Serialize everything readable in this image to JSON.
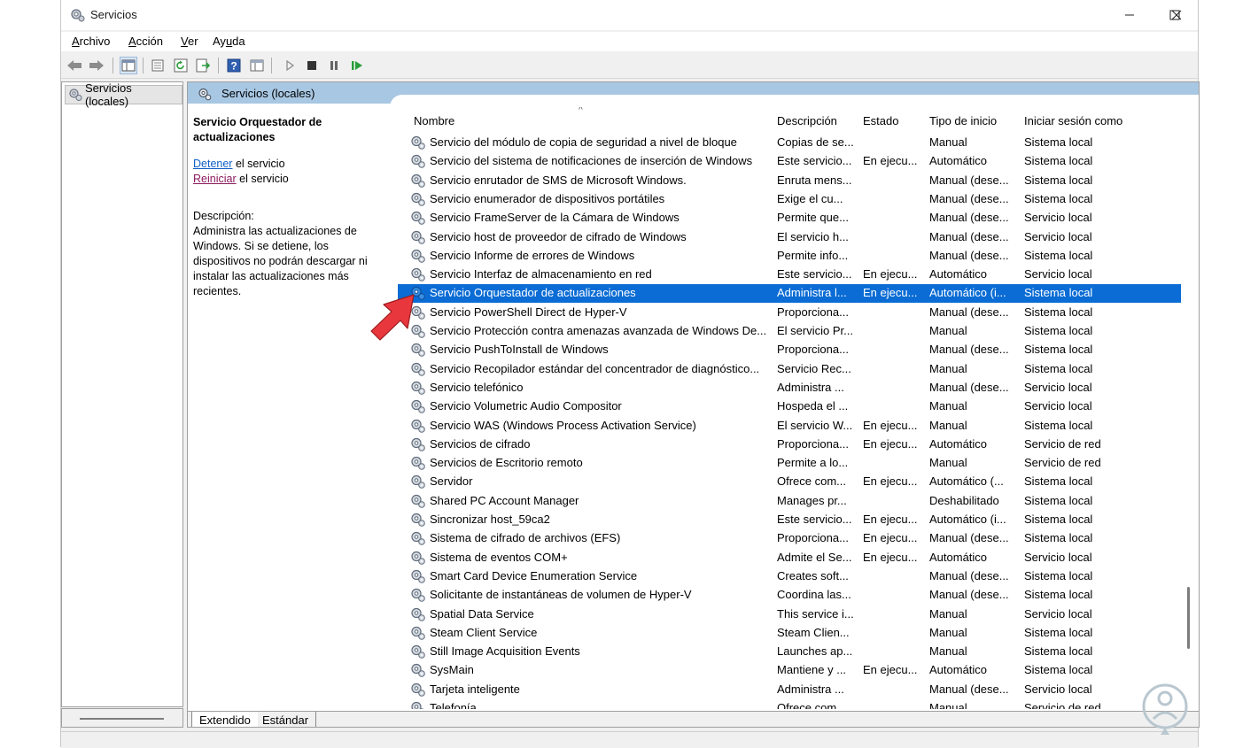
{
  "window": {
    "title": "Servicios"
  },
  "menu": [
    {
      "pre": "",
      "u": "A",
      "post": "rchivo"
    },
    {
      "pre": "",
      "u": "A",
      "post": "cción"
    },
    {
      "pre": "",
      "u": "V",
      "post": "er"
    },
    {
      "pre": "Ay",
      "u": "u",
      "post": "da"
    }
  ],
  "toolbar_icons": [
    "back-icon",
    "forward-icon",
    "show-tree-icon",
    "properties-icon",
    "refresh-icon",
    "export-icon",
    "help-icon",
    "view-icon",
    "play-icon",
    "stop-icon",
    "pause-icon",
    "restart-icon"
  ],
  "tree": {
    "root_label": "Servicios (locales)"
  },
  "main": {
    "header_title": "Servicios (locales)"
  },
  "info": {
    "service_name": "Servicio Orquestador de actualizaciones",
    "stop_link": "Detener",
    "stop_suffix": " el servicio",
    "restart_link": "Reiniciar",
    "restart_suffix": " el servicio",
    "desc_label": "Descripción:",
    "desc_text": "Administra las actualizaciones de Windows. Si se detiene, los dispositivos no podrán descargar ni instalar las actualizaciones más recientes."
  },
  "columns": [
    "Nombre",
    "Descripción",
    "Estado",
    "Tipo de inicio",
    "Iniciar sesión como"
  ],
  "rows": [
    [
      "Servicio del módulo de copia de seguridad a nivel de bloque",
      "Copias de se...",
      "",
      "Manual",
      "Sistema local"
    ],
    [
      "Servicio del sistema de notificaciones de inserción de Windows",
      "Este servicio...",
      "En ejecu...",
      "Automático",
      "Sistema local"
    ],
    [
      "Servicio enrutador de SMS de Microsoft Windows.",
      "Enruta mens...",
      "",
      "Manual (dese...",
      "Sistema local"
    ],
    [
      "Servicio enumerador de dispositivos portátiles",
      "Exige el cu...",
      "",
      "Manual (dese...",
      "Sistema local"
    ],
    [
      "Servicio FrameServer de la Cámara de Windows",
      "Permite que...",
      "",
      "Manual (dese...",
      "Servicio local"
    ],
    [
      "Servicio host de proveedor de cifrado de Windows",
      "El servicio h...",
      "",
      "Manual (dese...",
      "Servicio local"
    ],
    [
      "Servicio Informe de errores de Windows",
      "Permite info...",
      "",
      "Manual (dese...",
      "Sistema local"
    ],
    [
      "Servicio Interfaz de almacenamiento en red",
      "Este servicio...",
      "En ejecu...",
      "Automático",
      "Servicio local"
    ],
    [
      "Servicio Orquestador de actualizaciones",
      "Administra l...",
      "En ejecu...",
      "Automático (i...",
      "Sistema local"
    ],
    [
      "Servicio PowerShell Direct de Hyper-V",
      "Proporciona...",
      "",
      "Manual (dese...",
      "Sistema local"
    ],
    [
      "Servicio Protección contra amenazas avanzada de Windows De...",
      "El servicio Pr...",
      "",
      "Manual",
      "Sistema local"
    ],
    [
      "Servicio PushToInstall de Windows",
      "Proporciona...",
      "",
      "Manual (dese...",
      "Sistema local"
    ],
    [
      "Servicio Recopilador estándar del concentrador de diagnóstico...",
      "Servicio Rec...",
      "",
      "Manual",
      "Sistema local"
    ],
    [
      "Servicio telefónico",
      "Administra ...",
      "",
      "Manual (dese...",
      "Servicio local"
    ],
    [
      "Servicio Volumetric Audio Compositor",
      "Hospeda el ...",
      "",
      "Manual",
      "Servicio local"
    ],
    [
      "Servicio WAS (Windows Process Activation Service)",
      "El servicio W...",
      "En ejecu...",
      "Manual",
      "Sistema local"
    ],
    [
      "Servicios de cifrado",
      "Proporciona...",
      "En ejecu...",
      "Automático",
      "Servicio de red"
    ],
    [
      "Servicios de Escritorio remoto",
      "Permite a lo...",
      "",
      "Manual",
      "Servicio de red"
    ],
    [
      "Servidor",
      "Ofrece com...",
      "En ejecu...",
      "Automático (...",
      "Sistema local"
    ],
    [
      "Shared PC Account Manager",
      "Manages pr...",
      "",
      "Deshabilitado",
      "Sistema local"
    ],
    [
      "Sincronizar host_59ca2",
      "Este servicio...",
      "En ejecu...",
      "Automático (i...",
      "Sistema local"
    ],
    [
      "Sistema de cifrado de archivos (EFS)",
      "Proporciona...",
      "En ejecu...",
      "Manual (dese...",
      "Sistema local"
    ],
    [
      "Sistema de eventos COM+",
      "Admite el Se...",
      "En ejecu...",
      "Automático",
      "Servicio local"
    ],
    [
      "Smart Card Device Enumeration Service",
      "Creates soft...",
      "",
      "Manual (dese...",
      "Sistema local"
    ],
    [
      "Solicitante de instantáneas de volumen de Hyper-V",
      "Coordina las...",
      "",
      "Manual (dese...",
      "Sistema local"
    ],
    [
      "Spatial Data Service",
      "This service i...",
      "",
      "Manual",
      "Servicio local"
    ],
    [
      "Steam Client Service",
      "Steam Clien...",
      "",
      "Manual",
      "Sistema local"
    ],
    [
      "Still Image Acquisition Events",
      "Launches ap...",
      "",
      "Manual",
      "Sistema local"
    ],
    [
      "SysMain",
      "Mantiene y ...",
      "En ejecu...",
      "Automático",
      "Sistema local"
    ],
    [
      "Tarjeta inteligente",
      "Administra ...",
      "",
      "Manual (dese...",
      "Servicio local"
    ],
    [
      "Telefonía",
      "Ofrece com...",
      "",
      "Manual",
      "Servicio de red"
    ]
  ],
  "selected_row": 8,
  "tabs": [
    "Extendido",
    "Estándar"
  ],
  "colors": {
    "selection": "#0a6cd4",
    "header_band": "#a8c7e3",
    "arrow": "#e8383d"
  }
}
